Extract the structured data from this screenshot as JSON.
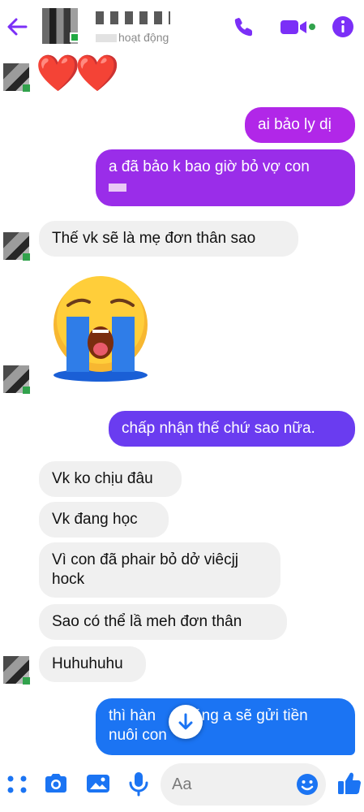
{
  "header": {
    "status_text": "hoạt động"
  },
  "messages": {
    "m1": "ai bảo ly dị",
    "m2_line1": "a đã bảo k bao giờ bỏ vợ con",
    "m3": "Thế vk sẽ là mẹ đơn thân sao",
    "m4": "chấp nhận thế chứ sao nữa.",
    "m5": "Vk ko chịu đâu",
    "m6": "Vk đang học",
    "m7_line1": "Vì con đã phair bỏ dở viêcjj",
    "m7_line2": "hock",
    "m8": "Sao có thể lầ meh đơn thân",
    "m9": "Huhuhuhu",
    "m10_line1": "thì hàn",
    "m10_line1b": "áng a sẽ gửi tiền",
    "m10_line2": "nuôi con"
  },
  "emoji": {
    "hearts": "❤️❤️"
  },
  "composer": {
    "placeholder": "Aa"
  },
  "colors": {
    "accent": "#7b2ff7",
    "bubble_out_top": "#b127e8",
    "bubble_out_mid": "#6a3cf0",
    "bubble_out_bottom": "#1b74f3",
    "incoming": "#f0f0f0",
    "online": "#31a24c"
  },
  "icons": [
    "back-arrow-icon",
    "phone-icon",
    "video-icon",
    "info-icon",
    "apps-icon",
    "camera-icon",
    "gallery-icon",
    "mic-icon",
    "emoji-icon",
    "like-icon",
    "scroll-down-icon"
  ]
}
